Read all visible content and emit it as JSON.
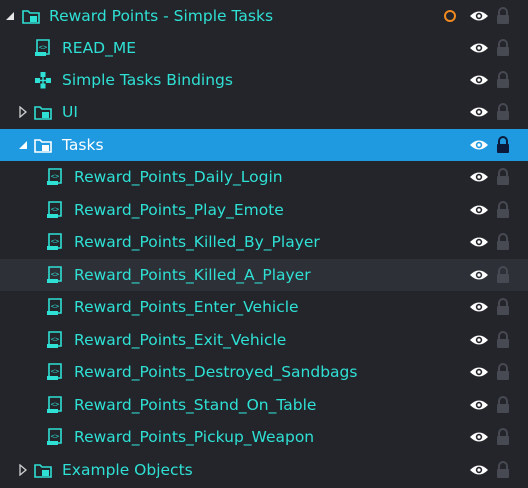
{
  "colors": {
    "background": "#23252b",
    "text": "#2fe0d4",
    "selected_background": "#1f9ae0",
    "hover_background": "#2e3038",
    "status_ring": "#f0891f"
  },
  "tree": {
    "root": {
      "label": "Reward Points - Simple Tasks",
      "icon": "folder-cube-icon",
      "expanded": true
    },
    "items": [
      {
        "label": "READ_ME",
        "icon": "script-icon"
      },
      {
        "label": "Simple Tasks Bindings",
        "icon": "bindings-icon"
      },
      {
        "label": "UI",
        "icon": "folder-cube-icon",
        "expanded": false
      },
      {
        "label": "Tasks",
        "icon": "folder-cube-icon",
        "expanded": true,
        "selected": true
      },
      {
        "label": "Reward_Points_Daily_Login",
        "icon": "script-icon"
      },
      {
        "label": "Reward_Points_Play_Emote",
        "icon": "script-icon"
      },
      {
        "label": "Reward_Points_Killed_By_Player",
        "icon": "script-icon"
      },
      {
        "label": "Reward_Points_Killed_A_Player",
        "icon": "script-icon",
        "hovered": true
      },
      {
        "label": "Reward_Points_Enter_Vehicle",
        "icon": "script-icon"
      },
      {
        "label": "Reward_Points_Exit_Vehicle",
        "icon": "script-icon"
      },
      {
        "label": "Reward_Points_Destroyed_Sandbags",
        "icon": "script-icon"
      },
      {
        "label": "Reward_Points_Stand_On_Table",
        "icon": "script-icon"
      },
      {
        "label": "Reward_Points_Pickup_Weapon",
        "icon": "script-icon"
      },
      {
        "label": "Example Objects",
        "icon": "folder-cube-icon",
        "expanded": false
      }
    ]
  }
}
